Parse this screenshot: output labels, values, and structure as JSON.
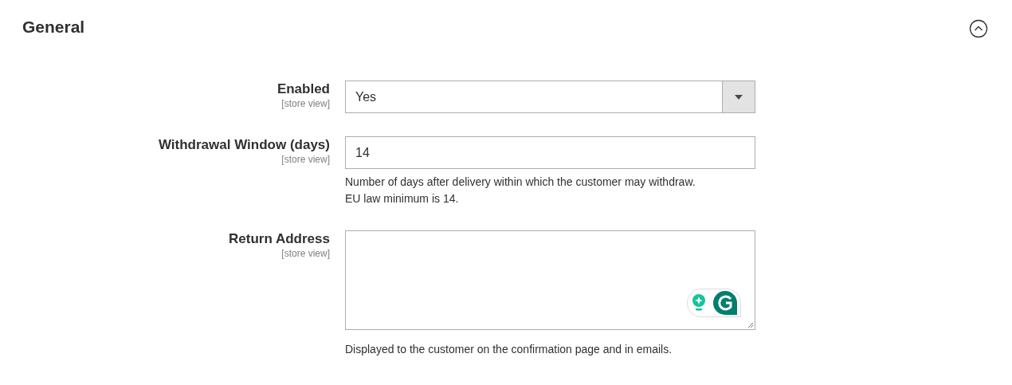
{
  "section": {
    "title": "General",
    "expanded": true
  },
  "fields": [
    {
      "kind": "select",
      "label": "Enabled",
      "scope": "[store view]",
      "value": "Yes"
    },
    {
      "kind": "text",
      "label": "Withdrawal Window (days)",
      "scope": "[store view]",
      "value": "14",
      "note_lines": [
        "Number of days after delivery within which the customer may withdraw.",
        "EU law minimum is 14."
      ]
    },
    {
      "kind": "textarea",
      "label": "Return Address",
      "scope": "[store view]",
      "note_lines": [
        "Displayed to the customer on the confirmation page and in emails."
      ]
    }
  ]
}
